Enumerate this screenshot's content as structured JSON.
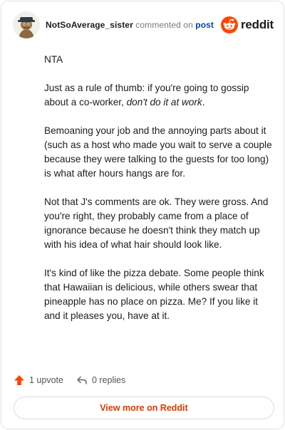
{
  "header": {
    "username": "NotSoAverage_sister",
    "action_text": "commented on",
    "post_link": "post",
    "brand": "reddit"
  },
  "comment": {
    "p1": "NTA",
    "p2_start": "Just as a rule of thumb: if you're going to gossip about a co-worker, ",
    "p2_emphasis": "don't do it at work",
    "p2_end": ".",
    "p3": "Bemoaning your job and the annoying parts about it (such as a host who made you wait to serve a couple because they were talking to the guests for too long) is what after hours hangs are for.",
    "p4": "Not that J's comments are ok. They were gross. And you're right, they probably came from a place of ignorance because he doesn't think they match up with his idea of what hair should look like.",
    "p5": "It's kind of like the pizza debate. Some people think that Hawaiian is delicious, while others swear that pineapple has no place on pizza. Me? If you like it and it pleases you, have at it."
  },
  "actions": {
    "upvote_label": "1 upvote",
    "replies_label": "0 replies"
  },
  "footer": {
    "view_more_label": "View more on Reddit"
  },
  "colors": {
    "brand_orange": "#ff4500",
    "link_blue": "#0045ac",
    "button_text": "#d93a00"
  },
  "icons": [
    "user-avatar-icon",
    "reddit-snoo-icon",
    "upvote-arrow-icon",
    "reply-arrow-icon"
  ]
}
